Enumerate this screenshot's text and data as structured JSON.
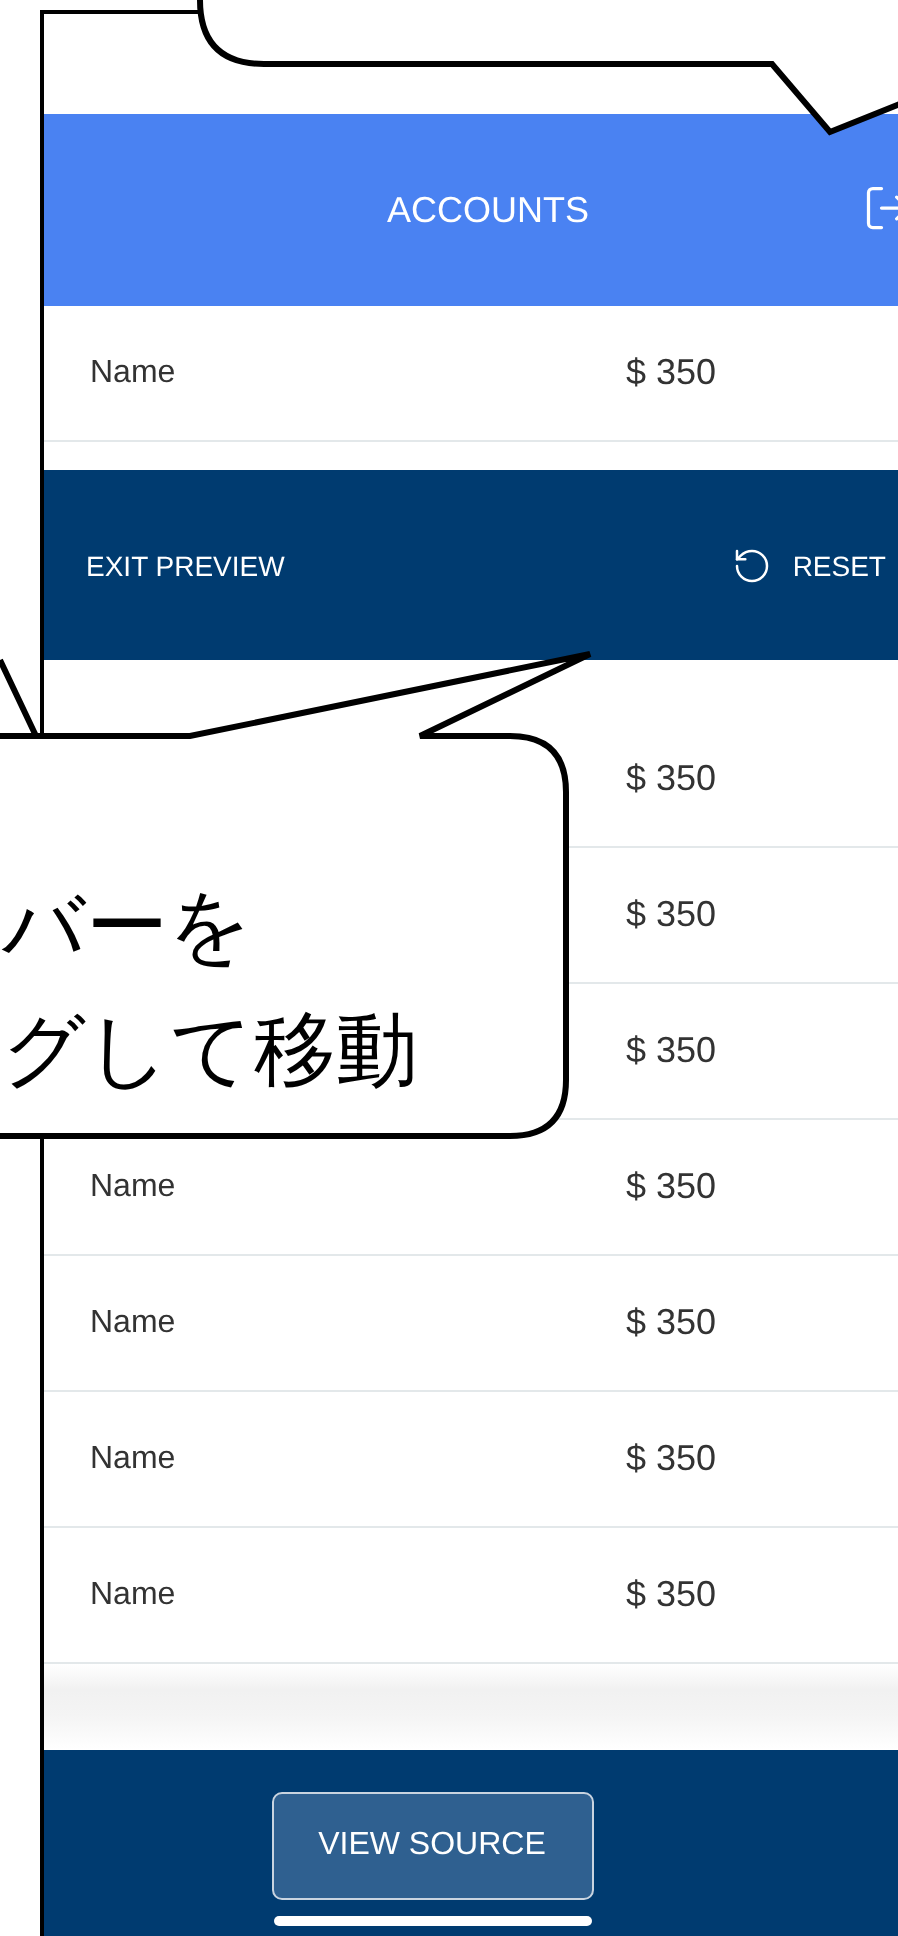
{
  "header": {
    "title": "ACCOUNTS"
  },
  "rows_above": [
    {
      "name": "Name",
      "amount": "$ 350"
    }
  ],
  "preview_bar": {
    "exit": "EXIT PREVIEW",
    "reset": "RESET"
  },
  "rows": [
    {
      "amount": "$ 350"
    },
    {
      "amount": "$ 350"
    },
    {
      "amount": "$ 350"
    },
    {
      "name": "Name",
      "amount": "$ 350"
    },
    {
      "name": "Name",
      "amount": "$ 350"
    },
    {
      "name": "Name",
      "amount": "$ 350"
    },
    {
      "name": "Name",
      "amount": "$ 350"
    }
  ],
  "footer": {
    "button": "VIEW SOURCE"
  },
  "callout": {
    "lines": [
      "バーを",
      "グして移動"
    ]
  }
}
